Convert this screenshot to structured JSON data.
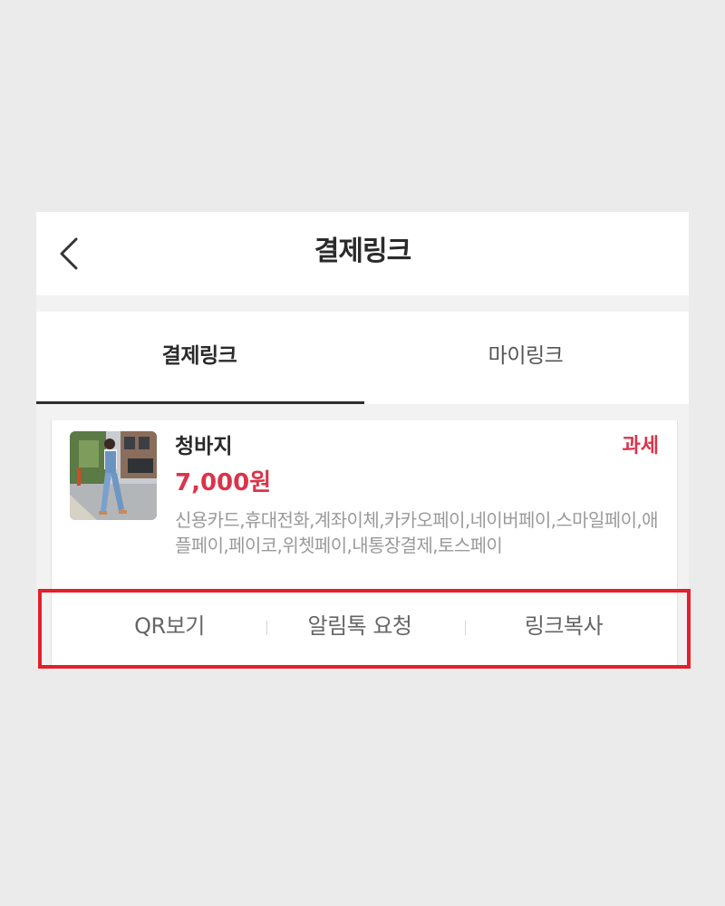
{
  "header": {
    "title": "결제링크",
    "back_icon": "chevron-left-icon"
  },
  "tabs": [
    {
      "label": "결제링크",
      "active": true
    },
    {
      "label": "마이링크",
      "active": false
    }
  ],
  "product": {
    "name": "청바지",
    "price": "7,000원",
    "tax_label": "과세",
    "payment_methods": "신용카드,휴대전화,계좌이체,카카오페이,네이버페이,스마일페이,애플페이,페이코,위쳇페이,내통장결제,토스페이"
  },
  "actions": {
    "qr_view": "QR보기",
    "alimtalk_request": "알림톡 요청",
    "copy_link": "링크복사"
  },
  "colors": {
    "accent": "#d9344b",
    "highlight": "#e3202c",
    "background": "#ebebeb"
  }
}
